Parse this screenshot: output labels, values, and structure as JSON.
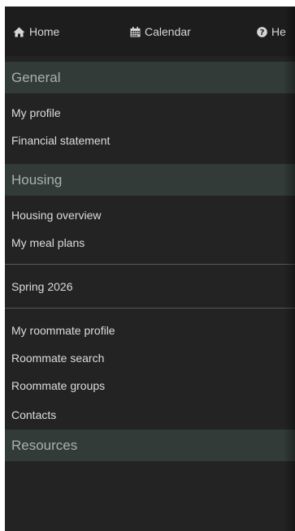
{
  "topnav": {
    "items": [
      {
        "label": "Home",
        "icon": "home-icon"
      },
      {
        "label": "Calendar",
        "icon": "calendar-icon"
      },
      {
        "label": "He",
        "icon": "help-icon"
      }
    ]
  },
  "menu": {
    "general": {
      "title": "General",
      "links": [
        "My profile",
        "Financial statement"
      ]
    },
    "housing": {
      "title": "Housing",
      "links": [
        "Housing overview",
        "My meal plans"
      ],
      "term": "Spring 2026",
      "roommate_links": [
        "My roommate profile",
        "Roommate search",
        "Roommate groups",
        "Contacts"
      ]
    },
    "resources": {
      "title": "Resources"
    }
  },
  "colors": {
    "background": "#232323",
    "nav_background": "#1d1d1d",
    "section_header": "#323b38",
    "section_text": "#a9b1ad",
    "link_text": "#dcdcdc"
  }
}
